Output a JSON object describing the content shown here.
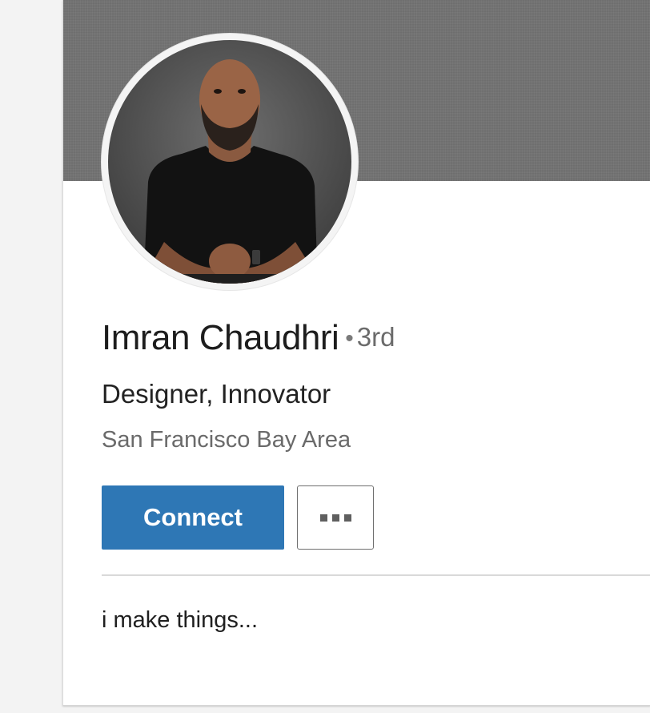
{
  "profile": {
    "name": "Imran Chaudhri",
    "degree_separator": "•",
    "degree": "3rd",
    "headline": "Designer, Innovator",
    "location": "San Francisco Bay Area",
    "summary": "i make things..."
  },
  "actions": {
    "connect_label": "Connect",
    "more_icon": "more-horizontal-icon"
  },
  "colors": {
    "banner": "#737373",
    "connect_button": "#2e77b5",
    "name_text": "#1d1d1d",
    "secondary_text": "#6a6a6a"
  }
}
